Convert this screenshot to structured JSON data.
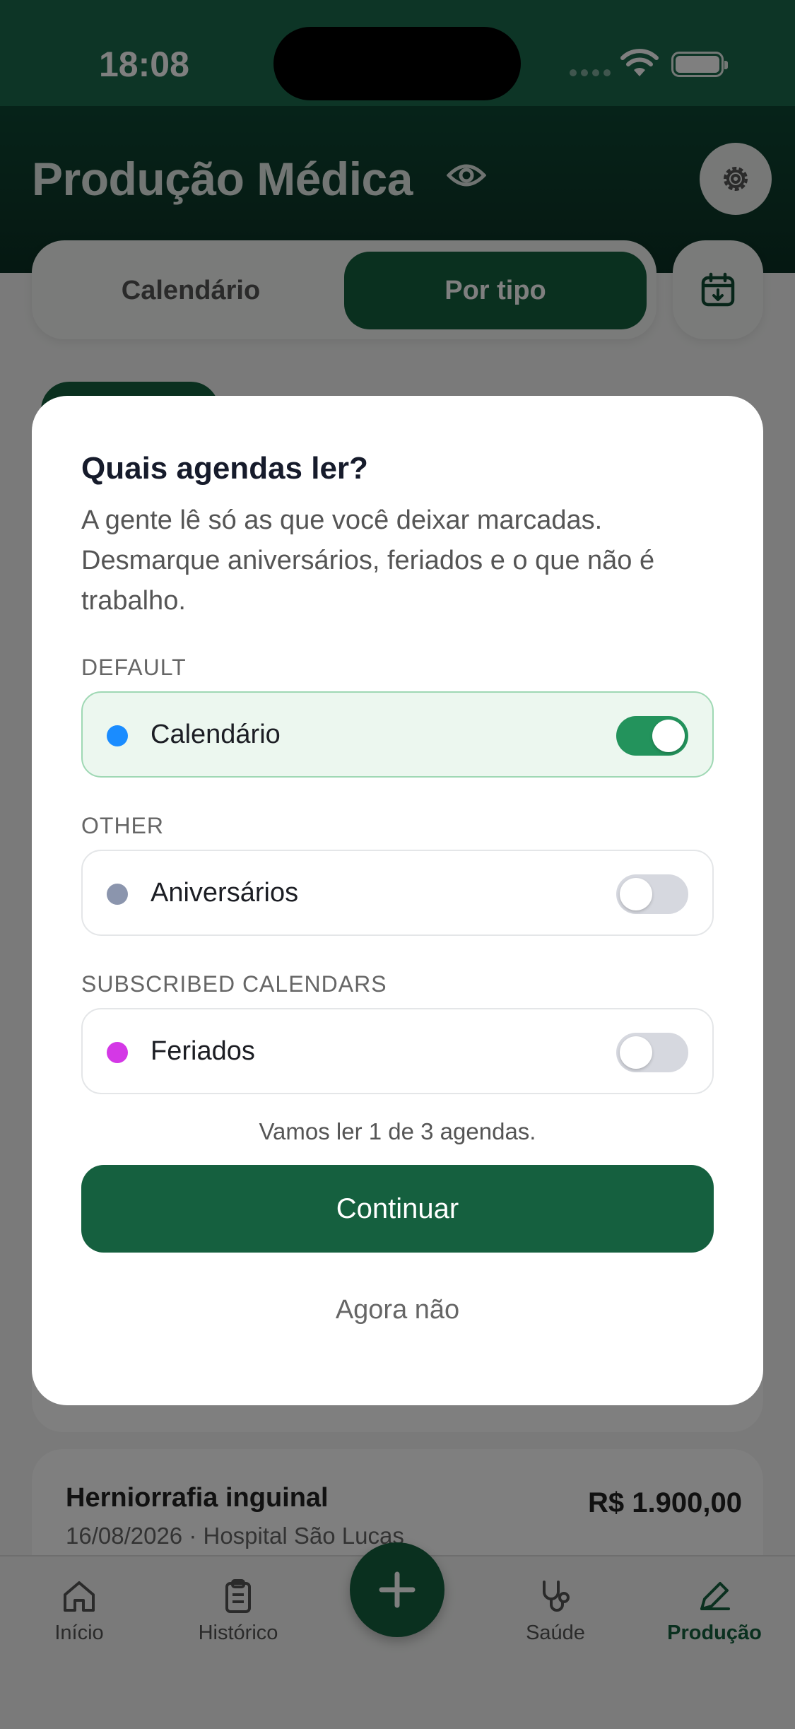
{
  "status_bar": {
    "time": "18:08"
  },
  "header": {
    "title": "Produção Médica"
  },
  "segment": {
    "tab1": "Calendário",
    "tab2": "Por tipo"
  },
  "background_card": {
    "title": "Herniorrafia inguinal",
    "subtitle": "16/08/2026 · Hospital São Lucas",
    "amount": "R$ 1.900,00"
  },
  "tabbar": {
    "items": [
      {
        "label": "Início"
      },
      {
        "label": "Histórico"
      },
      {
        "label": "Saúde"
      },
      {
        "label": "Produção"
      }
    ]
  },
  "modal": {
    "title": "Quais agendas ler?",
    "description": "A gente lê só as que você deixar marcadas. Desmarque aniversários, feriados e o que não é trabalho.",
    "sections": [
      {
        "label": "DEFAULT",
        "calendar": {
          "name": "Calendário",
          "color": "#1a8cff",
          "enabled": true
        }
      },
      {
        "label": "OTHER",
        "calendar": {
          "name": "Aniversários",
          "color": "#8b95ad",
          "enabled": false
        }
      },
      {
        "label": "SUBSCRIBED CALENDARS",
        "calendar": {
          "name": "Feriados",
          "color": "#d438e6",
          "enabled": false
        }
      }
    ],
    "count_text": "Vamos ler 1 de 3 agendas.",
    "continue_label": "Continuar",
    "later_label": "Agora não"
  }
}
